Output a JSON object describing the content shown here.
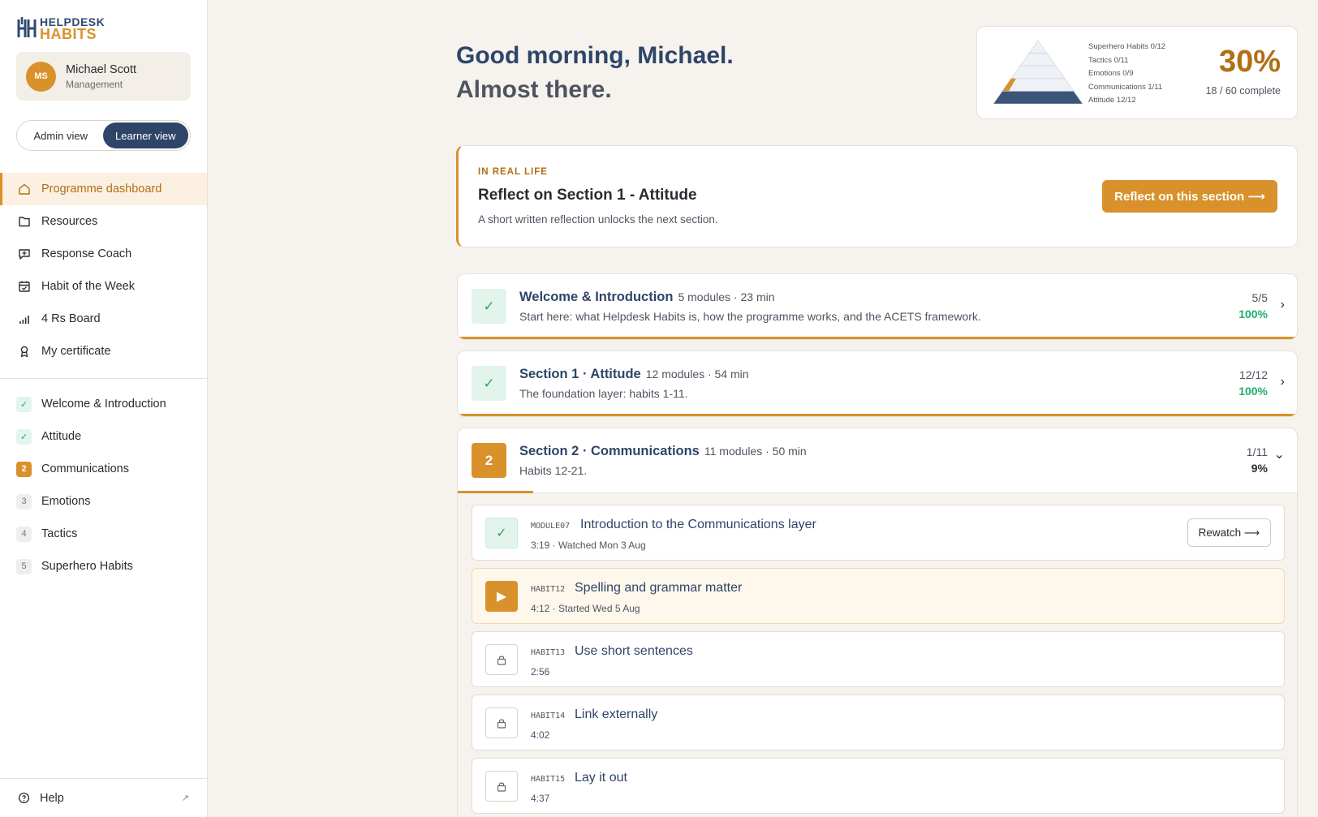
{
  "brand": {
    "line1": "HELPDESK",
    "line2": "HABITS"
  },
  "user": {
    "initials": "MS",
    "name": "Michael Scott",
    "role": "Management"
  },
  "view_toggle": {
    "admin": "Admin view",
    "learner": "Learner view",
    "selected": "Learner view"
  },
  "nav": [
    {
      "label": "Programme dashboard",
      "icon": "home-icon",
      "active": true
    },
    {
      "label": "Resources",
      "icon": "folder-icon"
    },
    {
      "label": "Response Coach",
      "icon": "chat-icon"
    },
    {
      "label": "Habit of the Week",
      "icon": "calendar-icon"
    },
    {
      "label": "4 Rs Board",
      "icon": "bar-chart-icon"
    },
    {
      "label": "My certificate",
      "icon": "award-icon"
    }
  ],
  "sidebar_sections": [
    {
      "badge": "✓",
      "label": "Welcome & Introduction",
      "state": "done"
    },
    {
      "badge": "✓",
      "label": "Attitude",
      "state": "done"
    },
    {
      "badge": "2",
      "label": "Communications",
      "state": "current"
    },
    {
      "badge": "3",
      "label": "Emotions",
      "state": "todo"
    },
    {
      "badge": "4",
      "label": "Tactics",
      "state": "todo"
    },
    {
      "badge": "5",
      "label": "Superhero Habits",
      "state": "todo"
    }
  ],
  "help": {
    "label": "Help",
    "arrow": "↗"
  },
  "greeting": {
    "line1": "Good morning, Michael.",
    "line2": "Almost there."
  },
  "progress": {
    "legend": [
      "Superhero Habits 0/12",
      "Tactics 0/11",
      "Emotions 0/9",
      "Communications 1/11",
      "Attitude 12/12"
    ],
    "percent_label": "30%",
    "complete_label": "18 / 60 complete",
    "layers": [
      {
        "name": "Superhero Habits",
        "fraction": 0
      },
      {
        "name": "Tactics",
        "fraction": 0
      },
      {
        "name": "Emotions",
        "fraction": 0
      },
      {
        "name": "Communications",
        "fraction": 0.09
      },
      {
        "name": "Attitude",
        "fraction": 1
      }
    ],
    "colors": {
      "complete": "#3b5578",
      "partial": "#d9912b",
      "empty": "#eef1f6"
    }
  },
  "reflect": {
    "tag": "IN REAL LIFE",
    "title": "Reflect on Section 1 - Attitude",
    "description": "A short written reflection unlocks the next section.",
    "button": "Reflect on this section ⟶"
  },
  "sections": [
    {
      "icon": "✓",
      "title": "Welcome & Introduction",
      "meta": "5 modules · 23 min",
      "description": "Start here: what Helpdesk Habits is, how the programme works, and the ACETS framework.",
      "count": "5/5",
      "percent": "100%",
      "progress": 1,
      "chevron": "›"
    },
    {
      "icon": "✓",
      "title": "Section 1 · Attitude",
      "meta": "12 modules · 54 min",
      "description": "The foundation layer: habits 1-11.",
      "count": "12/12",
      "percent": "100%",
      "progress": 1,
      "chevron": "›"
    },
    {
      "icon": "2",
      "title": "Section 2 · Communications",
      "meta": "11 modules · 50 min",
      "description": "Habits 12-21.",
      "count": "1/11",
      "percent": "9%",
      "progress": 0.09,
      "chevron": "⌄"
    }
  ],
  "modules": [
    {
      "code": "MODULE07",
      "title": "Introduction to the Communications layer",
      "duration": "3:19",
      "status": "Watched Mon 3 Aug",
      "state": "done",
      "icon": "✓",
      "action": "Rewatch ⟶"
    },
    {
      "code": "HABIT12",
      "title": "Spelling and grammar matter",
      "duration": "4:12",
      "status": "Started Wed 5 Aug",
      "state": "active",
      "icon": "▶"
    },
    {
      "code": "HABIT13",
      "title": "Use short sentences",
      "duration": "2:56",
      "state": "locked"
    },
    {
      "code": "HABIT14",
      "title": "Link externally",
      "duration": "4:02",
      "state": "locked"
    },
    {
      "code": "HABIT15",
      "title": "Lay it out",
      "duration": "4:37",
      "state": "locked"
    }
  ],
  "colors": {
    "accent": "#d9912b",
    "navy": "#2e4568",
    "success": "#1fae6d",
    "background": "#f6f3ee"
  }
}
